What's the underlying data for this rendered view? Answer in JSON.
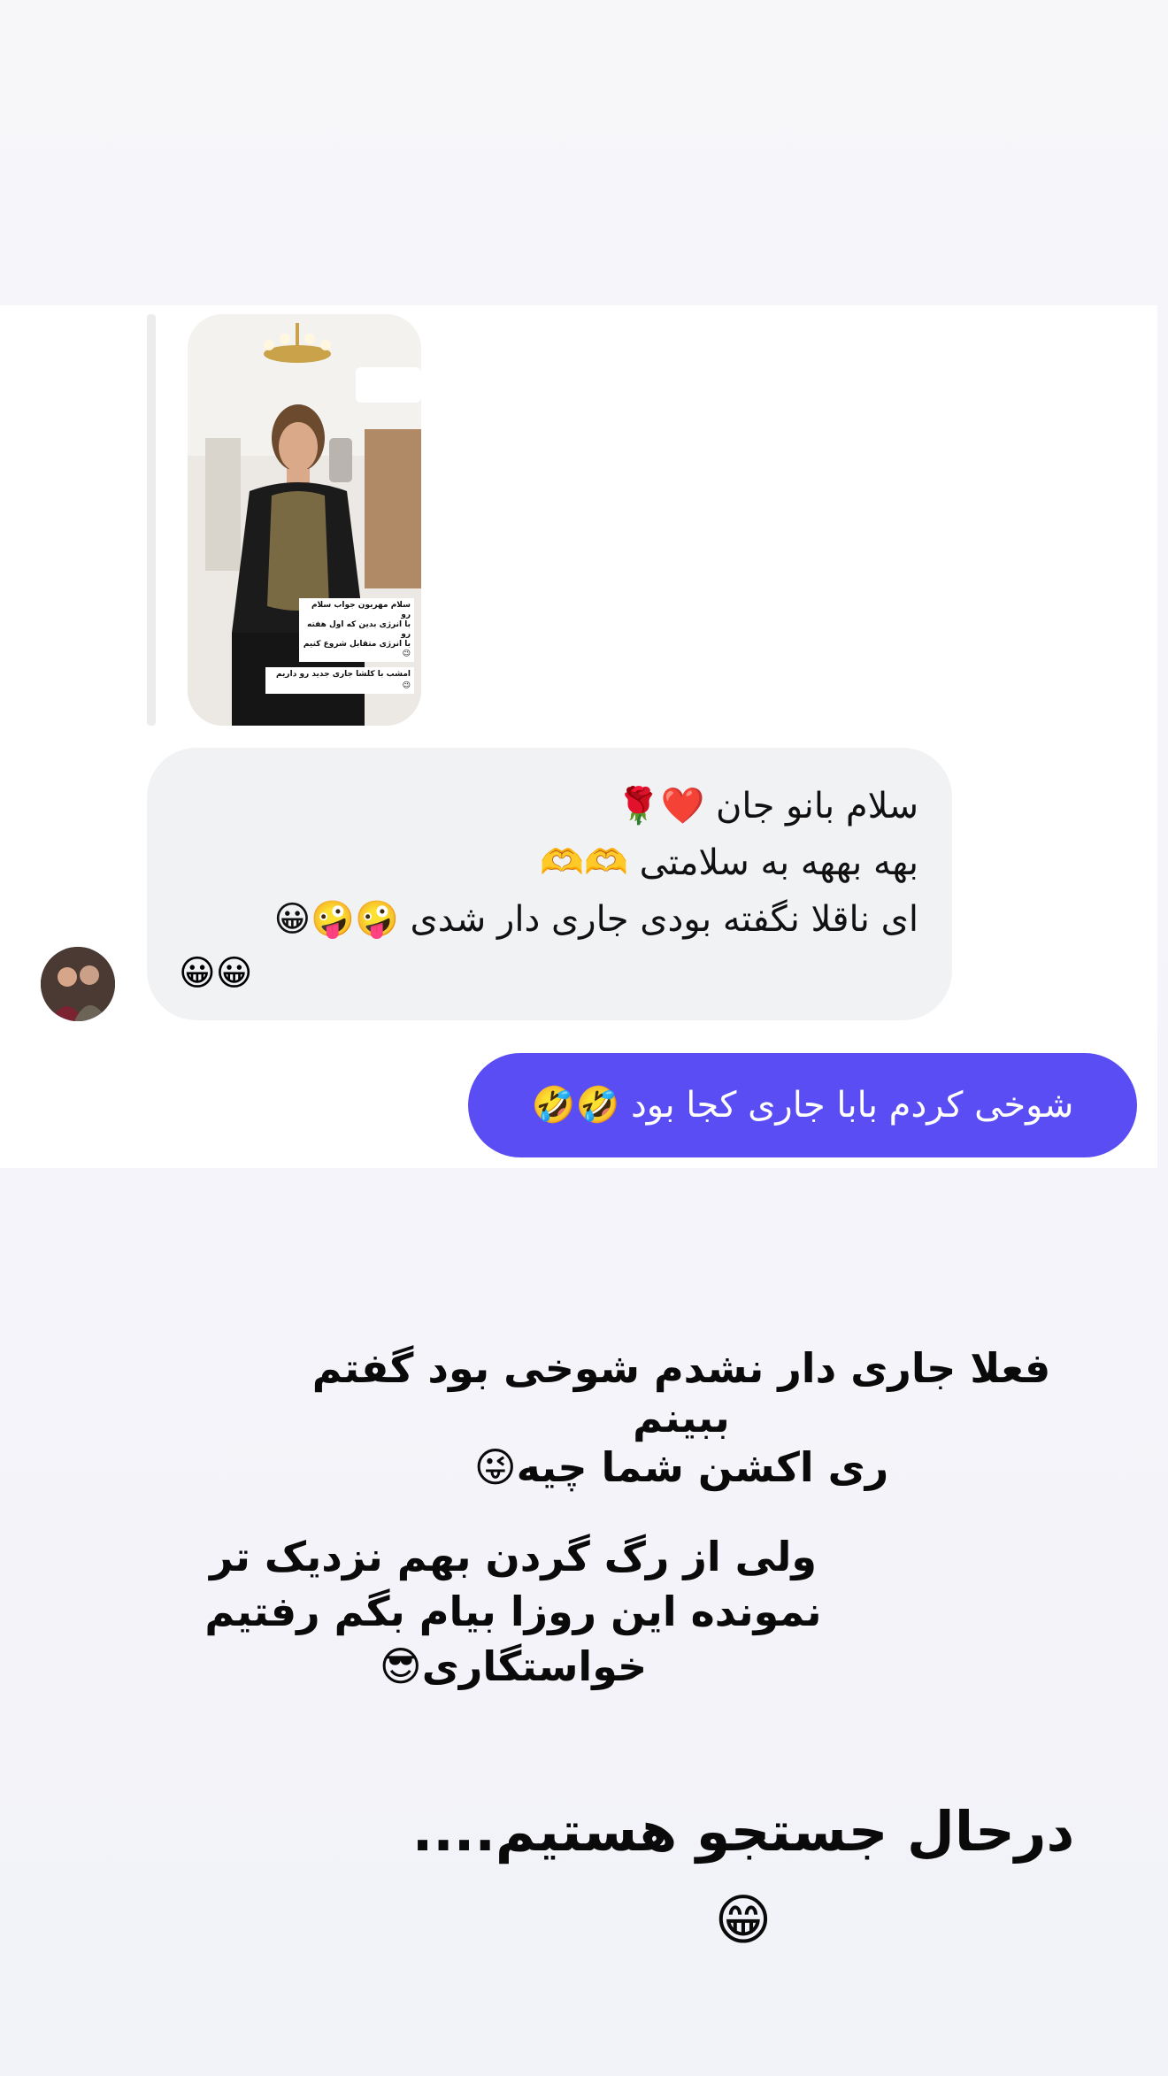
{
  "story_reply": {
    "caption_main": "سلام مهربون جواب سلام رو\nبا انرژی بدین که اول هفته رو\nبا انرژی متقابل شروع کنیم😉",
    "caption_footer": "امشب با کلشا جاری جدید رو داریم😉"
  },
  "incoming_message": {
    "lines": [
      "سلام بانو جان ❤️🌹",
      "بهه بههه به سلامتی 🫶🫶",
      "ای ناقلا نگفته بودی جاری دار شدی 🤪🤪😀"
    ],
    "trailing_emojis": "😀😀"
  },
  "outgoing_message": {
    "text": "شوخی کردم بابا جاری کجا بود 🤣🤣"
  },
  "story_text": {
    "paragraph_1": "فعلا جاری دار نشدم شوخی بود گفتم ببینم\nری اکشن شما چیه😜",
    "paragraph_2": "ولی از رگ گردن بهم نزدیک تر\nنمونده این روزا بیام بگم رفتیم\nخواستگاری😎",
    "paragraph_3": "درحال جستجو هستیم....😁"
  }
}
